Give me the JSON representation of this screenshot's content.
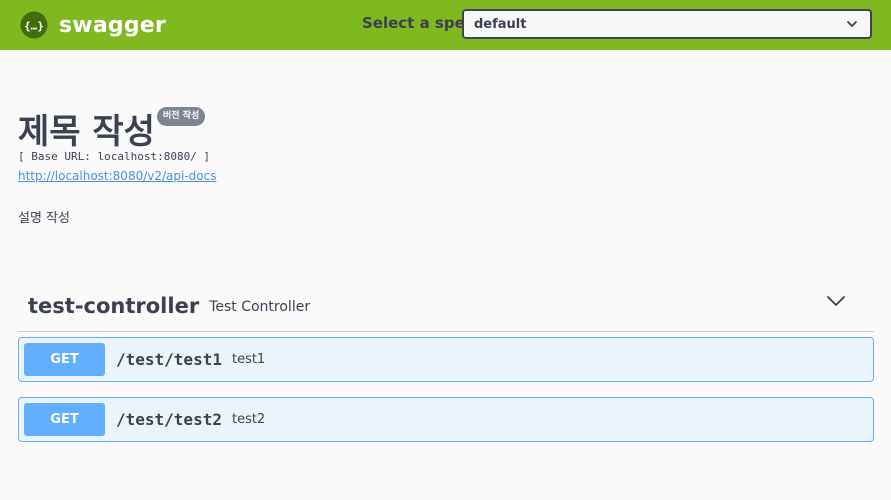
{
  "topbar": {
    "logo_text": "swagger",
    "spec_label": "Select a spec",
    "spec_selected": "default",
    "colors": {
      "background": "#7fb81f",
      "logo_circle": "#3f6e0b"
    }
  },
  "info": {
    "title": "제목 작성",
    "version": "버전 작성",
    "base_url": "[ Base URL: localhost:8080/ ]",
    "api_docs_link": "http://localhost:8080/v2/api-docs",
    "description": "설명 작성"
  },
  "tag": {
    "name": "test-controller",
    "description": "Test Controller"
  },
  "operations": [
    {
      "method": "GET",
      "path": "/test/test1",
      "summary": "test1"
    },
    {
      "method": "GET",
      "path": "/test/test2",
      "summary": "test2"
    }
  ],
  "colors": {
    "get_method": "#61affe",
    "get_background": "#ebf3fb",
    "text": "#3b4151",
    "link": "#4990e2",
    "version_badge": "#7d8492"
  },
  "icons": {
    "logo": "swagger-logo-icon",
    "select_chevron": "chevron-down-icon",
    "tag_chevron": "chevron-down-icon"
  }
}
